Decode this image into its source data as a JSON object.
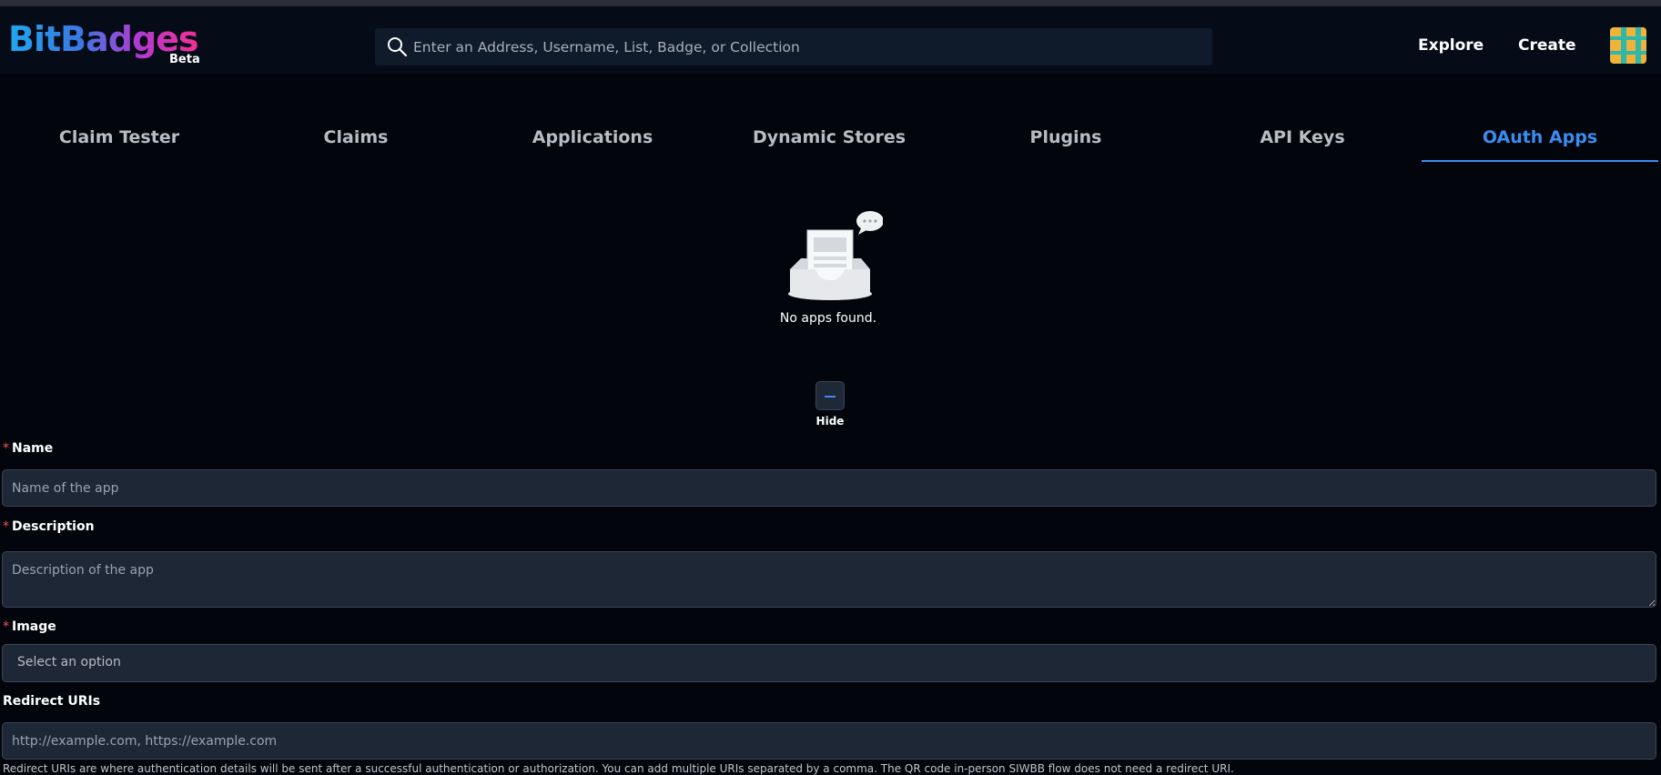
{
  "header": {
    "logo": "BitBadges",
    "logo_badge": "Beta",
    "search_placeholder": "Enter an Address, Username, List, Badge, or Collection",
    "nav": {
      "explore": "Explore",
      "create": "Create"
    }
  },
  "tabs": [
    {
      "label": "Claim Tester"
    },
    {
      "label": "Claims"
    },
    {
      "label": "Applications"
    },
    {
      "label": "Dynamic Stores"
    },
    {
      "label": "Plugins"
    },
    {
      "label": "API Keys"
    },
    {
      "label": "OAuth Apps",
      "active": true
    }
  ],
  "empty_state": {
    "text": "No apps found."
  },
  "toggle": {
    "label": "Hide"
  },
  "form": {
    "required_mark": "*",
    "name": {
      "label": "Name",
      "placeholder": "Name of the app"
    },
    "description": {
      "label": "Description",
      "placeholder": "Description of the app"
    },
    "image": {
      "label": "Image",
      "value": "Select an option"
    },
    "redirect": {
      "label": "Redirect URIs",
      "placeholder": "http://example.com, https://example.com",
      "help": "Redirect URIs are where authentication details will be sent after a successful authentication or authorization. You can add multiple URIs separated by a comma. The QR code in-person SIWBB flow does not need a redirect URI."
    }
  },
  "colors": {
    "accent": "#3b8cf0",
    "background": "#02060c",
    "required": "#ff4d4f"
  }
}
